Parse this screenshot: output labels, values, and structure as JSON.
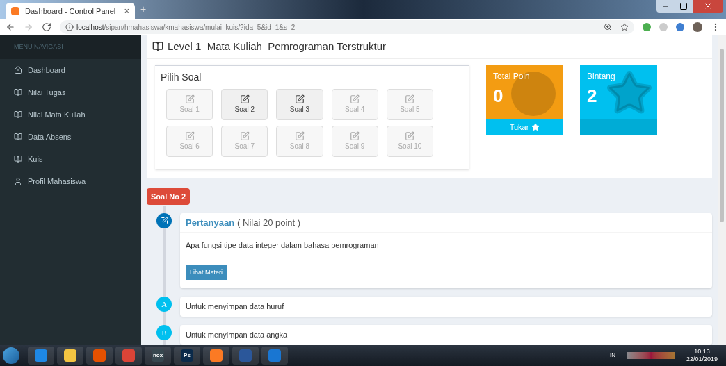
{
  "browser": {
    "tab_title": "Dashboard - Control Panel",
    "tab_close": "×",
    "new_tab": "+",
    "url_host": "localhost",
    "url_path": "/sipan/hmahasiswa/kmahasiswa/mulai_kuis/?ida=5&id=1&s=2"
  },
  "sidebar": {
    "header": "MENU NAVIGASI",
    "items": [
      {
        "label": "Dashboard",
        "kind": "home"
      },
      {
        "label": "Nilai Tugas",
        "kind": "book"
      },
      {
        "label": "Nilai Mata Kuliah",
        "kind": "book"
      },
      {
        "label": "Data Absensi",
        "kind": "book"
      },
      {
        "label": "Kuis",
        "kind": "book"
      },
      {
        "label": "Profil Mahasiswa",
        "kind": "user"
      }
    ]
  },
  "page_title": "Level 1  Mata Kuliah  Pemrograman Terstruktur",
  "question_picker": {
    "title": "Pilih Soal",
    "questions": [
      {
        "label": "Soal 1",
        "disabled": true
      },
      {
        "label": "Soal 2",
        "disabled": false
      },
      {
        "label": "Soal 3",
        "disabled": false
      },
      {
        "label": "Soal 4",
        "disabled": true
      },
      {
        "label": "Soal 5",
        "disabled": true
      },
      {
        "label": "Soal 6",
        "disabled": true
      },
      {
        "label": "Soal 7",
        "disabled": true
      },
      {
        "label": "Soal 8",
        "disabled": true
      },
      {
        "label": "Soal 9",
        "disabled": true
      },
      {
        "label": "Soal 10",
        "disabled": true
      }
    ]
  },
  "stats": [
    {
      "title": "Total Poin",
      "value": "0",
      "kind": "points",
      "color": "#f39c12",
      "footer": "Tukar"
    },
    {
      "title": "Bintang",
      "value": "2",
      "kind": "stars",
      "color": "#00c0ef"
    }
  ],
  "question": {
    "badge": "Soal No 2",
    "heading": "Pertanyaan",
    "score": "( Nilai 20 point )",
    "text": "Apa fungsi tipe data integer dalam bahasa pemrograman",
    "button": "Lihat Materi"
  },
  "answers": [
    {
      "letter": "A",
      "text": "Untuk menyimpan data huruf"
    },
    {
      "letter": "B",
      "text": "Untuk menyimpan data angka"
    }
  ],
  "taskbar": {
    "apps": [
      {
        "kind": "ie"
      },
      {
        "kind": "folder"
      },
      {
        "kind": "media"
      },
      {
        "kind": "chrome"
      },
      {
        "kind": "nox",
        "label": "nox"
      },
      {
        "kind": "ps",
        "label": "Ps"
      },
      {
        "kind": "xampp"
      },
      {
        "kind": "word"
      },
      {
        "kind": "vscode"
      }
    ],
    "language": "IN",
    "time": "10:13",
    "date": "22/01/2019"
  }
}
